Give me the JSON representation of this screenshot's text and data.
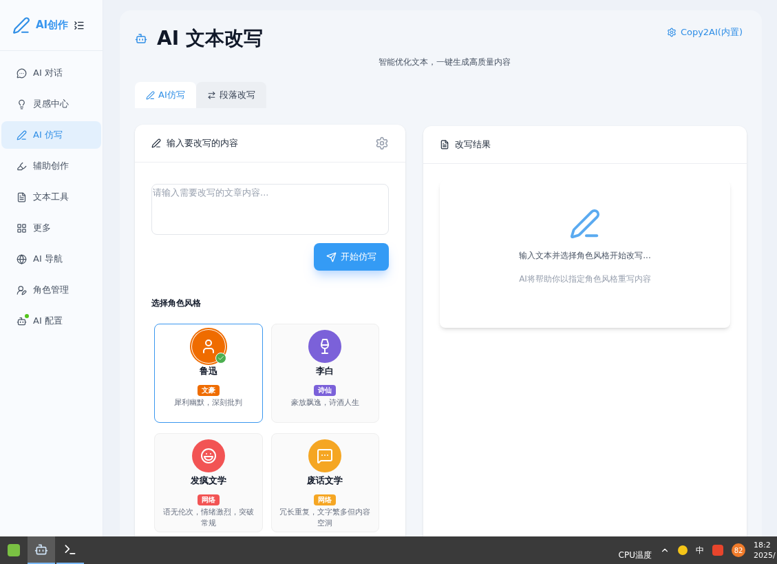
{
  "sidebar": {
    "logo": "AI创作",
    "items": [
      {
        "label": "AI 对话",
        "selected": false,
        "notified": false
      },
      {
        "label": "灵感中心",
        "selected": false,
        "notified": false
      },
      {
        "label": "AI 仿写",
        "selected": true,
        "notified": false
      },
      {
        "label": "辅助创作",
        "selected": false,
        "notified": false
      },
      {
        "label": "文本工具",
        "selected": false,
        "notified": false
      },
      {
        "label": "更多",
        "selected": false,
        "notified": false
      },
      {
        "label": "AI 导航",
        "selected": false,
        "notified": false
      },
      {
        "label": "角色管理",
        "selected": false,
        "notified": false
      },
      {
        "label": "AI 配置",
        "selected": false,
        "notified": true
      }
    ]
  },
  "header": {
    "title": "AI 文本改写",
    "subtitle": "智能优化文本，一键生成高质量内容",
    "provider": "Copy2AI(内置)"
  },
  "tabs": [
    {
      "label": "AI仿写",
      "selected": true
    },
    {
      "label": "段落改写",
      "selected": false
    }
  ],
  "input_panel": {
    "title": "输入要改写的内容",
    "placeholder": "请输入需要改写的文章内容...",
    "submit": "开始仿写",
    "section": "选择角色风格",
    "roles": [
      {
        "name": "鲁迅",
        "tag": "文豪",
        "color": "#ef6c00",
        "description": "犀利幽默，深刻批判",
        "selected": true
      },
      {
        "name": "李白",
        "tag": "诗仙",
        "color": "#7b61d9",
        "description": "豪放飘逸，诗酒人生",
        "selected": false
      },
      {
        "name": "发疯文学",
        "tag": "网络",
        "color": "#f25454",
        "description": "语无伦次，情绪激烈，突破常规",
        "selected": false
      },
      {
        "name": "废话文学",
        "tag": "网络",
        "color": "#f5a623",
        "description": "冗长重复，文字繁多但内容空洞",
        "selected": false
      }
    ]
  },
  "result_panel": {
    "title": "改写结果",
    "empty_title": "输入文本并选择角色风格开始改写...",
    "empty_hint": "AI将帮助你以指定角色风格重写内容"
  },
  "taskbar": {
    "cpu_label": "CPU温度",
    "ime": "中",
    "badge": "82",
    "time": "18:2",
    "date": "2025/"
  }
}
